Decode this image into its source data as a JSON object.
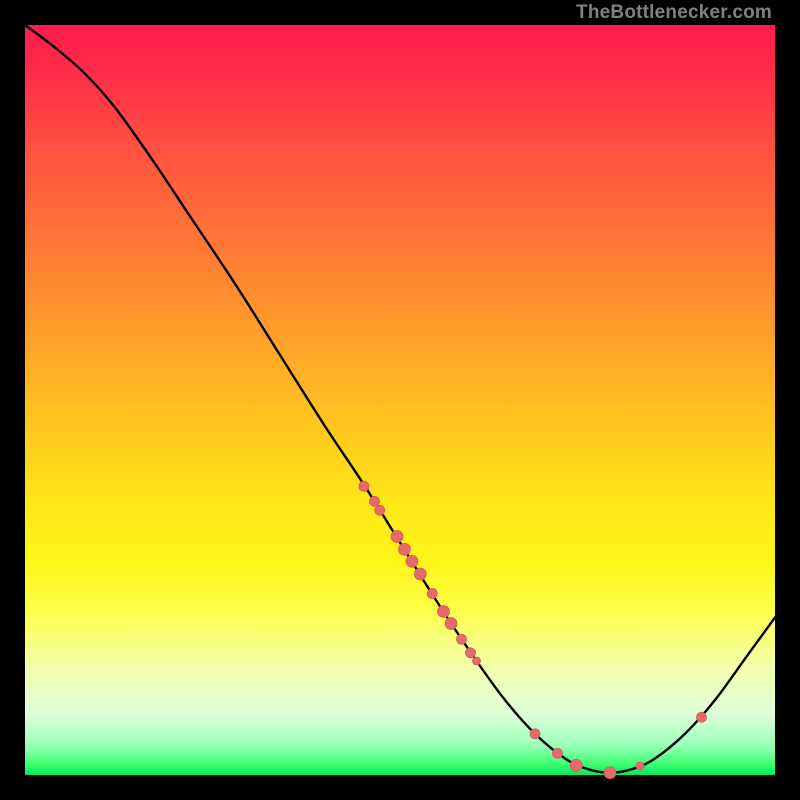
{
  "attribution": "TheBottlenecker.com",
  "colors": {
    "curve_stroke": "#000000",
    "marker_fill": "#e56a6a",
    "marker_stroke": "#d85a5a",
    "gradient_top": "#ff1a4d",
    "gradient_bottom": "#00e85d"
  },
  "chart_data": {
    "type": "line",
    "title": "",
    "xlabel": "",
    "ylabel": "",
    "xlim": [
      0,
      100
    ],
    "ylim": [
      0,
      100
    ],
    "curve_note": "y ≈ bottleneck mismatch %, curve falls from ~100 to ~0 near x≈77 then rises; values estimated from pixels",
    "curve": [
      {
        "x": 0,
        "y": 100
      },
      {
        "x": 4,
        "y": 97
      },
      {
        "x": 8,
        "y": 93.5
      },
      {
        "x": 12,
        "y": 89
      },
      {
        "x": 17,
        "y": 82
      },
      {
        "x": 22,
        "y": 74.5
      },
      {
        "x": 28,
        "y": 65.5
      },
      {
        "x": 34,
        "y": 56
      },
      {
        "x": 40,
        "y": 46.5
      },
      {
        "x": 45,
        "y": 39
      },
      {
        "x": 50,
        "y": 31
      },
      {
        "x": 55,
        "y": 23
      },
      {
        "x": 60,
        "y": 15.5
      },
      {
        "x": 64,
        "y": 10
      },
      {
        "x": 68,
        "y": 5.5
      },
      {
        "x": 72,
        "y": 2.2
      },
      {
        "x": 75,
        "y": 0.8
      },
      {
        "x": 78,
        "y": 0.3
      },
      {
        "x": 81,
        "y": 0.8
      },
      {
        "x": 84,
        "y": 2.2
      },
      {
        "x": 88,
        "y": 5.5
      },
      {
        "x": 92,
        "y": 10
      },
      {
        "x": 96,
        "y": 15.5
      },
      {
        "x": 100,
        "y": 21
      }
    ],
    "markers": [
      {
        "x": 45.2,
        "y": 38.5,
        "r": 5
      },
      {
        "x": 46.6,
        "y": 36.5,
        "r": 5
      },
      {
        "x": 47.3,
        "y": 35.3,
        "r": 5
      },
      {
        "x": 49.6,
        "y": 31.8,
        "r": 6
      },
      {
        "x": 50.6,
        "y": 30.1,
        "r": 6
      },
      {
        "x": 51.6,
        "y": 28.5,
        "r": 6
      },
      {
        "x": 52.7,
        "y": 26.8,
        "r": 6
      },
      {
        "x": 54.3,
        "y": 24.2,
        "r": 5
      },
      {
        "x": 55.8,
        "y": 21.8,
        "r": 6
      },
      {
        "x": 56.8,
        "y": 20.2,
        "r": 6
      },
      {
        "x": 58.2,
        "y": 18.1,
        "r": 5
      },
      {
        "x": 59.4,
        "y": 16.3,
        "r": 5
      },
      {
        "x": 60.2,
        "y": 15.2,
        "r": 4
      },
      {
        "x": 68.0,
        "y": 5.5,
        "r": 5
      },
      {
        "x": 71.0,
        "y": 2.9,
        "r": 5
      },
      {
        "x": 73.5,
        "y": 1.3,
        "r": 6
      },
      {
        "x": 78.0,
        "y": 0.3,
        "r": 6
      },
      {
        "x": 82.0,
        "y": 1.2,
        "r": 4
      },
      {
        "x": 90.2,
        "y": 7.7,
        "r": 5
      }
    ]
  }
}
